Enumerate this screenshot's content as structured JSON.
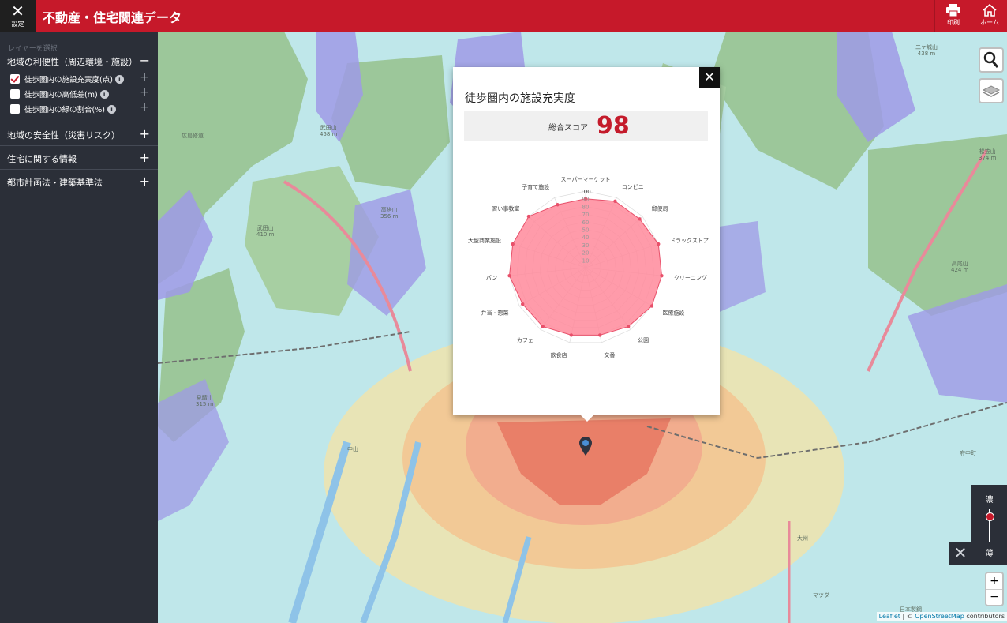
{
  "header": {
    "close_icon": "close-icon",
    "close_label": "設定",
    "title": "不動産・住宅関連データ",
    "print_label": "印刷",
    "home_label": "ホーム",
    "brand_color": "#c6192a"
  },
  "sidebar": {
    "hint": "レイヤーを選択",
    "sections": [
      {
        "title": "地域の利便性（周辺環境・施設）",
        "toggle": "−",
        "layers": [
          {
            "label": "徒歩圏内の施設充実度(点)",
            "checked": true,
            "info": "i",
            "plus": "+"
          },
          {
            "label": "徒歩圏内の高低差(m)",
            "checked": false,
            "info": "i",
            "plus": "+"
          },
          {
            "label": "徒歩圏内の緑の割合(%)",
            "checked": false,
            "info": "i",
            "plus": "+"
          }
        ]
      },
      {
        "title": "地域の安全性（災害リスク）",
        "toggle": "+"
      },
      {
        "title": "住宅に関する情報",
        "toggle": "+"
      },
      {
        "title": "都市計画法・建築基準法",
        "toggle": "+"
      }
    ]
  },
  "popup": {
    "close": "✕",
    "title": "徒歩圏内の施設充実度",
    "score_label": "総合スコア",
    "score_value": "98",
    "score_color": "#c41b2b"
  },
  "chart_data": {
    "type": "radar",
    "categories": [
      "スーパーマーケット",
      "コンビニ",
      "郵便局",
      "ドラッグストア",
      "クリーニング",
      "医療施設",
      "公園",
      "交番",
      "飲食店",
      "カフェ",
      "弁当・惣菜",
      "パン",
      "大型商業施設",
      "習い事教室",
      "子育て施設"
    ],
    "series": [
      {
        "values": [
          90,
          95,
          95,
          100,
          100,
          100,
          95,
          90,
          90,
          95,
          95,
          100,
          100,
          100,
          90
        ]
      }
    ],
    "rlim": [
      0,
      100
    ],
    "ticks": [
      "10",
      "20",
      "30",
      "40",
      "50",
      "60",
      "70",
      "80",
      "90",
      "100"
    ],
    "fill_color": "#ff8a9b",
    "stroke_color": "#e8506a"
  },
  "map": {
    "labels": [
      "広島修道",
      "武田山\n410 m",
      "高塔山\n356 m",
      "武田山\n458 m",
      "見晴山\n315 m",
      "二ケ城山\n438 m",
      "松笠山\n374 m",
      "高尾山\n424 m",
      "中山",
      "府中町",
      "大州",
      "日本製鋼",
      "マツダ"
    ],
    "zoom_in": "+",
    "zoom_out": "−",
    "legend_dark": "濃",
    "legend_light": "薄",
    "legend_close": "✕"
  },
  "attribution": {
    "leaflet": "Leaflet",
    "sep": " | © ",
    "osm": "OpenStreetMap",
    "suffix": " contributors"
  }
}
